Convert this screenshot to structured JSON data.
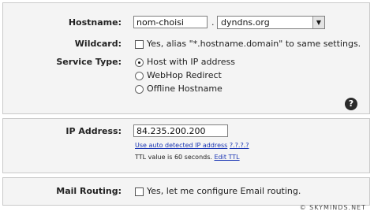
{
  "hostname": {
    "label": "Hostname:",
    "value": "nom-choisi",
    "separator": ".",
    "domain_selected": "dyndns.org"
  },
  "wildcard": {
    "label": "Wildcard:",
    "option_text": "Yes, alias \"*.hostname.domain\" to same settings."
  },
  "service_type": {
    "label": "Service Type:",
    "options": [
      "Host with IP address",
      "WebHop Redirect",
      "Offline Hostname"
    ],
    "selected": "Host with IP address"
  },
  "help": {
    "glyph": "?",
    "icon": "help-icon"
  },
  "ip": {
    "label": "IP Address:",
    "value": "84.235.200.200",
    "auto_link_text": "Use auto detected IP address",
    "auto_link_ip": "?.?.?.?",
    "ttl_text": "TTL value is 60 seconds.",
    "edit_ttl": "Edit TTL"
  },
  "mail": {
    "label": "Mail Routing:",
    "option_text": "Yes, let me configure Email routing."
  },
  "watermark": {
    "text": "SKYMINDS.NET",
    "icon": "copyright-icon"
  }
}
